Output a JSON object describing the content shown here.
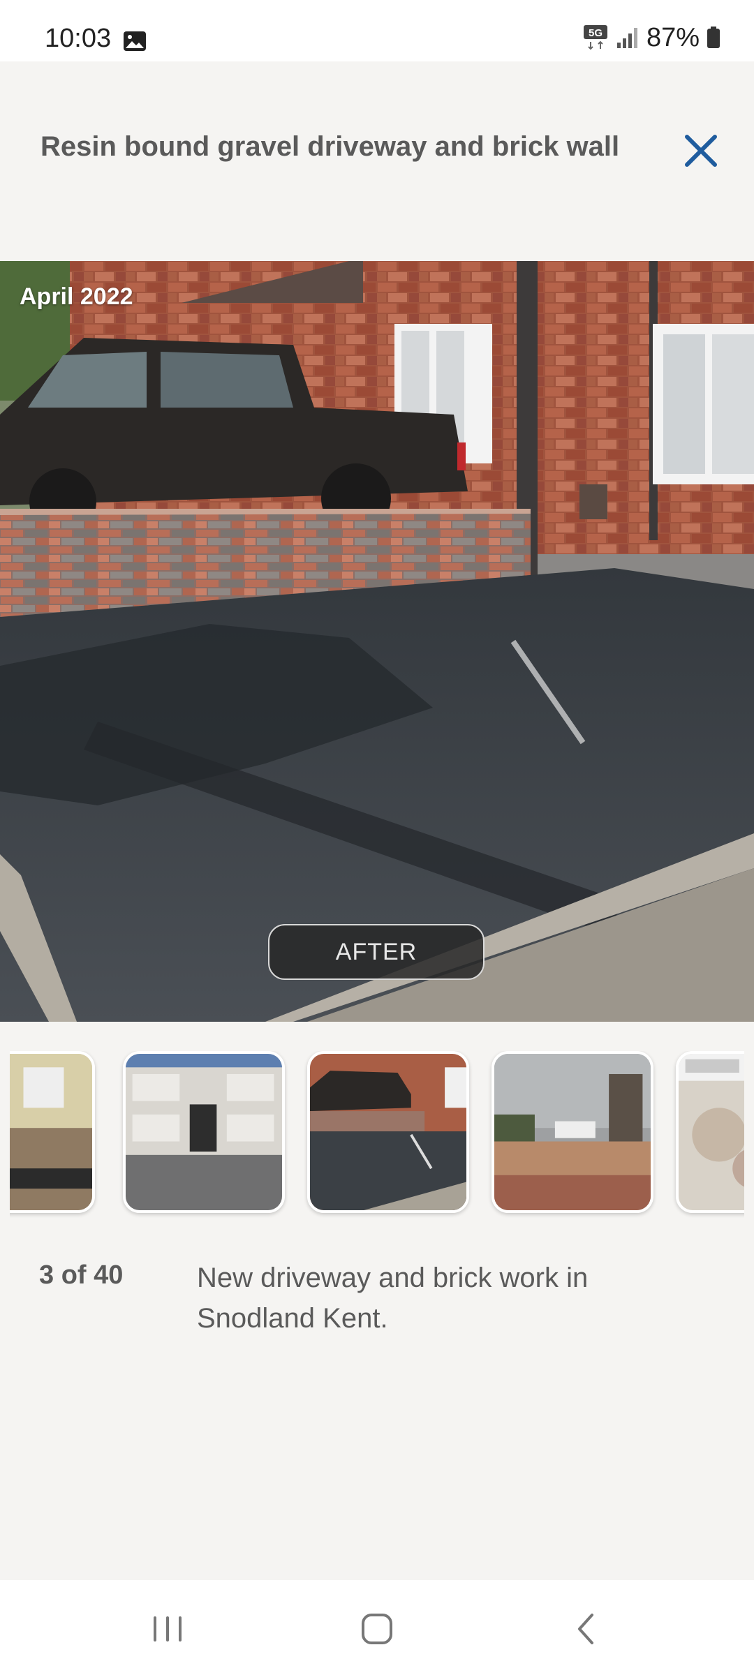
{
  "status": {
    "time": "10:03",
    "network": "5G",
    "battery": "87%",
    "icons": [
      "image-icon",
      "5g-icon",
      "signal-icon",
      "battery-icon"
    ]
  },
  "header": {
    "title": "Resin bound gravel driveway and brick wall",
    "close_icon": "close-icon",
    "accent_color": "#1f5c9e"
  },
  "photo": {
    "date": "April 2022",
    "label": "AFTER"
  },
  "gallery": {
    "current": 3,
    "total": 40,
    "counter_text": "3 of 40",
    "caption": "New driveway and brick work in Snodland Kent."
  },
  "nav": {
    "icons": [
      "recent-apps-icon",
      "home-icon",
      "back-icon"
    ]
  }
}
